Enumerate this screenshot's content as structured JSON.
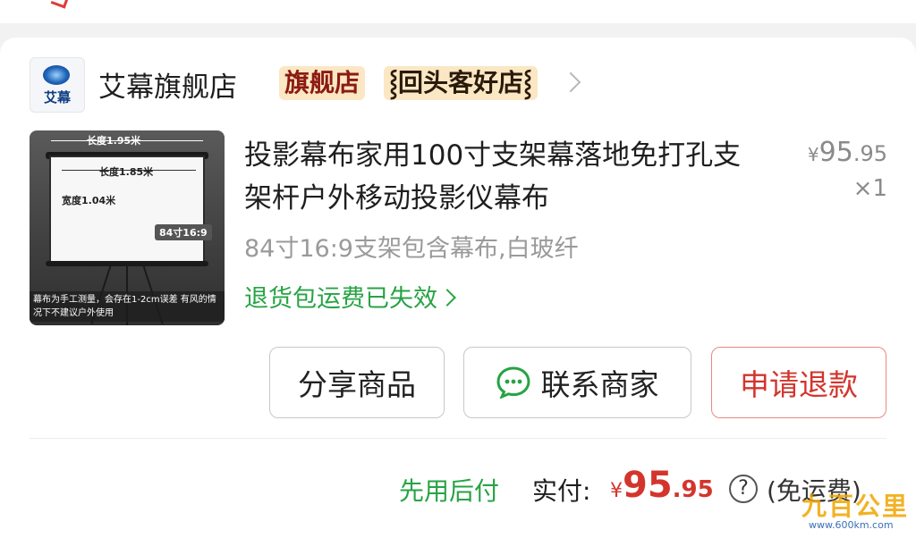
{
  "shop": {
    "logo_text": "艾幕",
    "name": "艾幕旗舰店",
    "badge_flagship": "旗舰店",
    "badge_repeat": "⸾回头客好店⸾"
  },
  "product": {
    "image": {
      "dim_outer_width": "长度1.95米",
      "dim_screen_width": "长度1.85米",
      "dim_height": "宽度1.04米",
      "size_tag": "84寸16:9",
      "note": "幕布为手工测量，会存在1-2cm误差 有风的情况下不建议户外使用"
    },
    "title": "投影幕布家用100寸支架幕落地免打孔支架杆户外移动投影仪幕布",
    "price_symbol": "¥",
    "price_int": "95",
    "price_dec": ".95",
    "quantity": "×1",
    "spec": "84寸16:9支架包含幕布,白玻纤",
    "return_notice": "退货包运费已失效"
  },
  "actions": {
    "share": "分享商品",
    "contact": "联系商家",
    "refund": "申请退款"
  },
  "footer": {
    "pay_later": "先用后付",
    "paid_label": "实付:",
    "total_symbol": "¥",
    "total_int": "95",
    "total_dec": ".95",
    "help": "?",
    "shipping": "(免运费)"
  },
  "watermark": {
    "main": "九百公里",
    "sub": "www.600km.com"
  },
  "colors": {
    "green": "#27a344",
    "red": "#d3352d",
    "badge_bg": "#fbe7c4"
  }
}
